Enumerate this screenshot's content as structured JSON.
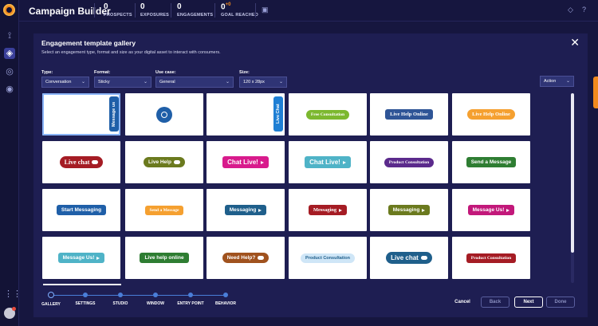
{
  "app": {
    "title": "Campaign Builder",
    "stats": [
      {
        "value": "0",
        "label": "PROSPECTS"
      },
      {
        "value": "0",
        "label": "EXPOSURES"
      },
      {
        "value": "0",
        "label": "ENGAGEMENTS"
      },
      {
        "value": "0",
        "delta": "+0",
        "label": "GOAL REACHED"
      }
    ]
  },
  "modal": {
    "title": "Engagement template gallery",
    "subtitle": "Select an engagement type, format and size as your digital asset to interact with consumers.",
    "filters": {
      "type": {
        "label": "Type:",
        "value": "Conversation"
      },
      "format": {
        "label": "Format:",
        "value": "Sticky"
      },
      "use_case": {
        "label": "Use case:",
        "value": "General"
      },
      "size": {
        "label": "Size:",
        "value": "120 x 28px"
      },
      "action": {
        "value": "Action"
      }
    },
    "tiles": [
      {
        "text": "Message us",
        "color": "#1f5fa8",
        "style": "vertical"
      },
      {
        "text": "",
        "color": "#1f5fa8",
        "style": "circle"
      },
      {
        "text": "Live Chat",
        "color": "#1f7fd4",
        "style": "vertical"
      },
      {
        "text": "Free Consultation",
        "color": "#7cb82f",
        "style": "pill serif small"
      },
      {
        "text": "Live Help Online",
        "color": "#2f5597",
        "style": "rect serif"
      },
      {
        "text": "Live Help Online",
        "color": "#f5a030",
        "style": "pill serif"
      },
      {
        "text": "Live chat",
        "color": "#a51c24",
        "style": "pill serif big bubble"
      },
      {
        "text": "Live Help",
        "color": "#6b7a1e",
        "style": "pill bubble"
      },
      {
        "text": "Chat Live!",
        "color": "#d81b8c",
        "style": "rect big tri"
      },
      {
        "text": "Chat Live!",
        "color": "#4fb3c7",
        "style": "rect big tri"
      },
      {
        "text": "Product Consultation",
        "color": "#5b2a8c",
        "style": "pill serif small"
      },
      {
        "text": "Send a Message",
        "color": "#2e7d32",
        "style": "rect"
      },
      {
        "text": "Start Messaging",
        "color": "#1f5fa8",
        "style": "rect"
      },
      {
        "text": "Send a Message",
        "color": "#f5a030",
        "style": "rect serif small"
      },
      {
        "text": "Messaging",
        "color": "#1f5f8b",
        "style": "rect tri"
      },
      {
        "text": "Messaging",
        "color": "#a51c24",
        "style": "rect serif tri"
      },
      {
        "text": "Messaging",
        "color": "#6b7a1e",
        "style": "rect tri"
      },
      {
        "text": "Message Us!",
        "color": "#c2187a",
        "style": "rect tri"
      },
      {
        "text": "Message Us!",
        "color": "#4fb3c7",
        "style": "rect tri"
      },
      {
        "text": "Live help online",
        "color": "#2e7d32",
        "style": "rect"
      },
      {
        "text": "Need Help?",
        "color": "#a0521e",
        "style": "pill bubble"
      },
      {
        "text": "Product Consultation",
        "color": "#cfe6f7",
        "style": "pill small darktext"
      },
      {
        "text": "Live chat",
        "color": "#1f5f8b",
        "style": "pill big bubble"
      },
      {
        "text": "Product Consultation",
        "color": "#a51c24",
        "style": "rect serif small"
      }
    ]
  },
  "stepper": {
    "steps": [
      "GALLERY",
      "SETTINGS",
      "STUDIO",
      "WINDOW",
      "ENTRY POINT",
      "BEHAVIOR"
    ]
  },
  "footer": {
    "cancel": "Cancel",
    "back": "Back",
    "next": "Next",
    "done": "Done"
  }
}
